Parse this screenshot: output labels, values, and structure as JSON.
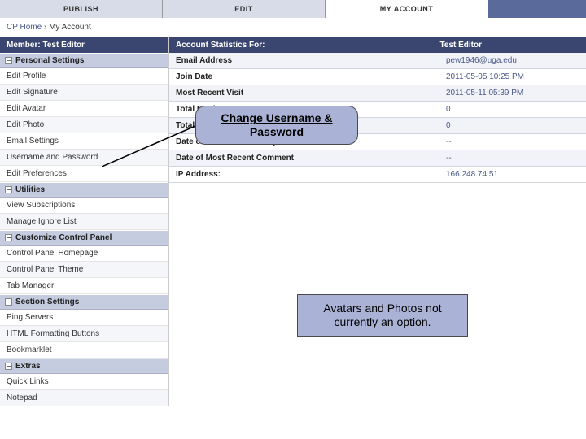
{
  "tabs": {
    "publish": "PUBLISH",
    "edit": "EDIT",
    "myaccount": "MY ACCOUNT"
  },
  "breadcrumb": {
    "home": "CP Home",
    "sep": "›",
    "current": "My Account"
  },
  "member_label": "Member:",
  "member_name": "Test Editor",
  "sections": {
    "personal": {
      "title": "Personal Settings",
      "items": [
        "Edit Profile",
        "Edit Signature",
        "Edit Avatar",
        "Edit Photo",
        "Email Settings",
        "Username and Password",
        "Edit Preferences"
      ]
    },
    "utilities": {
      "title": "Utilities",
      "items": [
        "View Subscriptions",
        "Manage Ignore List"
      ]
    },
    "customize": {
      "title": "Customize Control Panel",
      "items": [
        "Control Panel Homepage",
        "Control Panel Theme",
        "Tab Manager"
      ]
    },
    "section_settings": {
      "title": "Section Settings",
      "items": [
        "Ping Servers",
        "HTML Formatting Buttons",
        "Bookmarklet"
      ]
    },
    "extras": {
      "title": "Extras",
      "items": [
        "Quick Links",
        "Notepad"
      ]
    }
  },
  "stats_header": {
    "label": "Account Statistics For:",
    "name": "Test Editor"
  },
  "stats": [
    {
      "label": "Email Address",
      "value": "pew1946@uga.edu"
    },
    {
      "label": "Join Date",
      "value": "2011-05-05 10:25 PM"
    },
    {
      "label": "Most Recent Visit",
      "value": "2011-05-11 05:39 PM"
    },
    {
      "label": "Total Entries",
      "value": "0"
    },
    {
      "label": "Total Comments",
      "value": "0"
    },
    {
      "label": "Date of Most Recent Entry",
      "value": "--"
    },
    {
      "label": "Date of Most Recent Comment",
      "value": "--"
    },
    {
      "label": "IP Address:",
      "value": "166.248.74.51"
    }
  ],
  "callouts": {
    "changePw": "Change Username & Password",
    "avatars": "Avatars and Photos not currently an option."
  }
}
